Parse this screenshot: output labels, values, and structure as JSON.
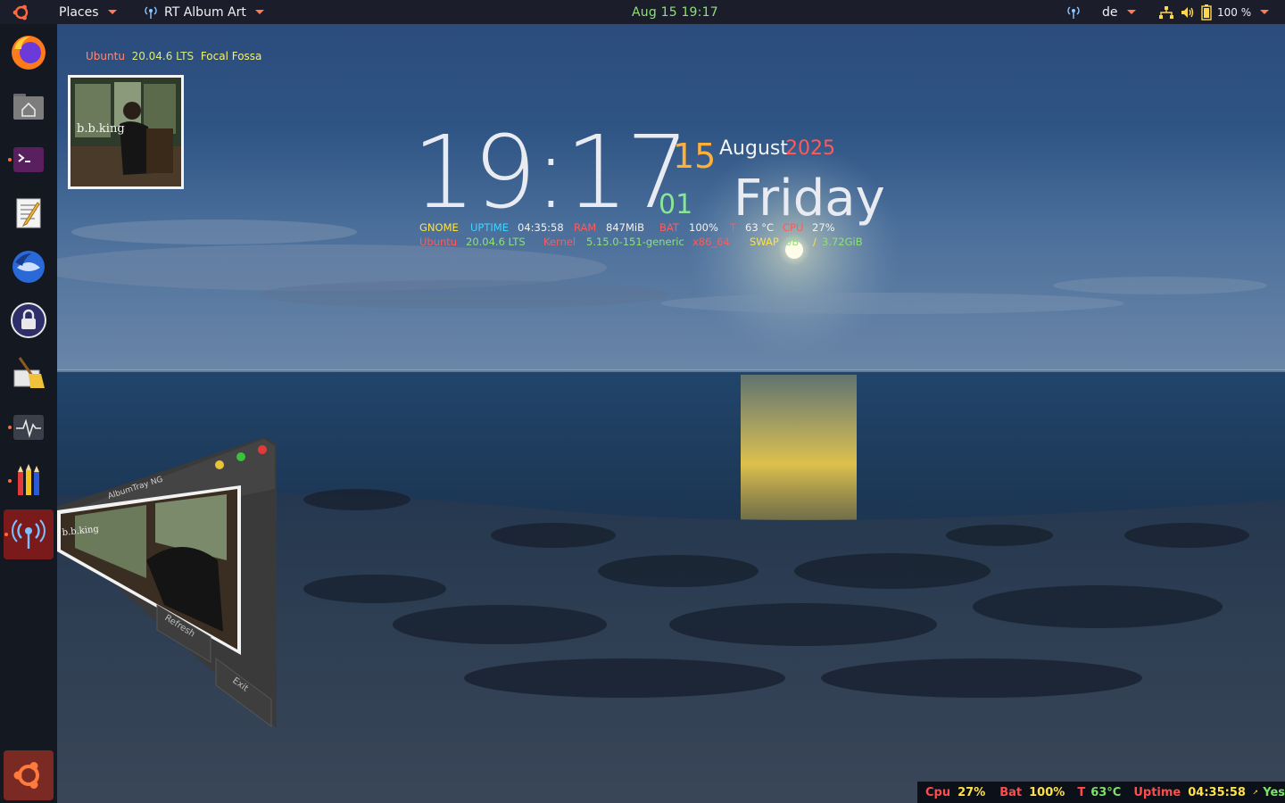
{
  "topbar": {
    "places_label": "Places",
    "app_label": "RT Album Art",
    "datetime": "Aug 15  19:17",
    "keyboard_layout": "de",
    "battery_percent": "100 %"
  },
  "dock": {
    "items": [
      {
        "name": "firefox"
      },
      {
        "name": "home-folder"
      },
      {
        "name": "terminal"
      },
      {
        "name": "text-editor"
      },
      {
        "name": "thunderbird"
      },
      {
        "name": "keepassxc"
      },
      {
        "name": "bleachbit"
      },
      {
        "name": "system-monitor"
      },
      {
        "name": "color-pencils"
      },
      {
        "name": "rt-album-art"
      },
      {
        "name": "show-applications"
      }
    ]
  },
  "desktop": {
    "os_line": {
      "distro": "Ubuntu",
      "version": "20.04.6 LTS",
      "codename": "Focal Fossa"
    },
    "clock": {
      "time": "19:17",
      "day": "15",
      "month": "August",
      "year": "2025",
      "week": "01",
      "weekday": "Friday"
    },
    "stats_row1": {
      "de_label": "GNOME",
      "uptime_label": "UPTIME",
      "uptime_value": "04:35:58",
      "ram_label": "RAM",
      "ram_value": "847MiB",
      "bat_label": "BAT",
      "bat_value": "100%",
      "temp_label": "T",
      "temp_value": "63 °C",
      "cpu_label": "CPU",
      "cpu_value": "27%"
    },
    "stats_row2": {
      "distro_label": "Ubuntu",
      "distro_value": "20.04.6 LTS",
      "kernel_label": "Kernel",
      "kernel_value": "5.15.0-151-generic",
      "arch": "x86_64",
      "swap_label": "SWAP",
      "swap_used": "0B",
      "swap_sep": "/",
      "swap_total": "3.72GiB"
    }
  },
  "album_window": {
    "title": "AlbumTray NG",
    "album_text": "b.b.king",
    "refresh_label": "Refresh",
    "exit_label": "Exit"
  },
  "status": {
    "cpu_label": "Cpu",
    "cpu_value": "27%",
    "bat_label": "Bat",
    "bat_value": "100%",
    "temp_label": "T",
    "temp_value": "63°C",
    "uptime_label": "Uptime",
    "uptime_value": "04:35:58",
    "update_status": "Yes"
  },
  "colors": {
    "topbar_bg": "#1b1d2a",
    "dock_bg": "#141820",
    "accent_orange": "#ff7a55",
    "clock_green": "#8fe07a"
  }
}
